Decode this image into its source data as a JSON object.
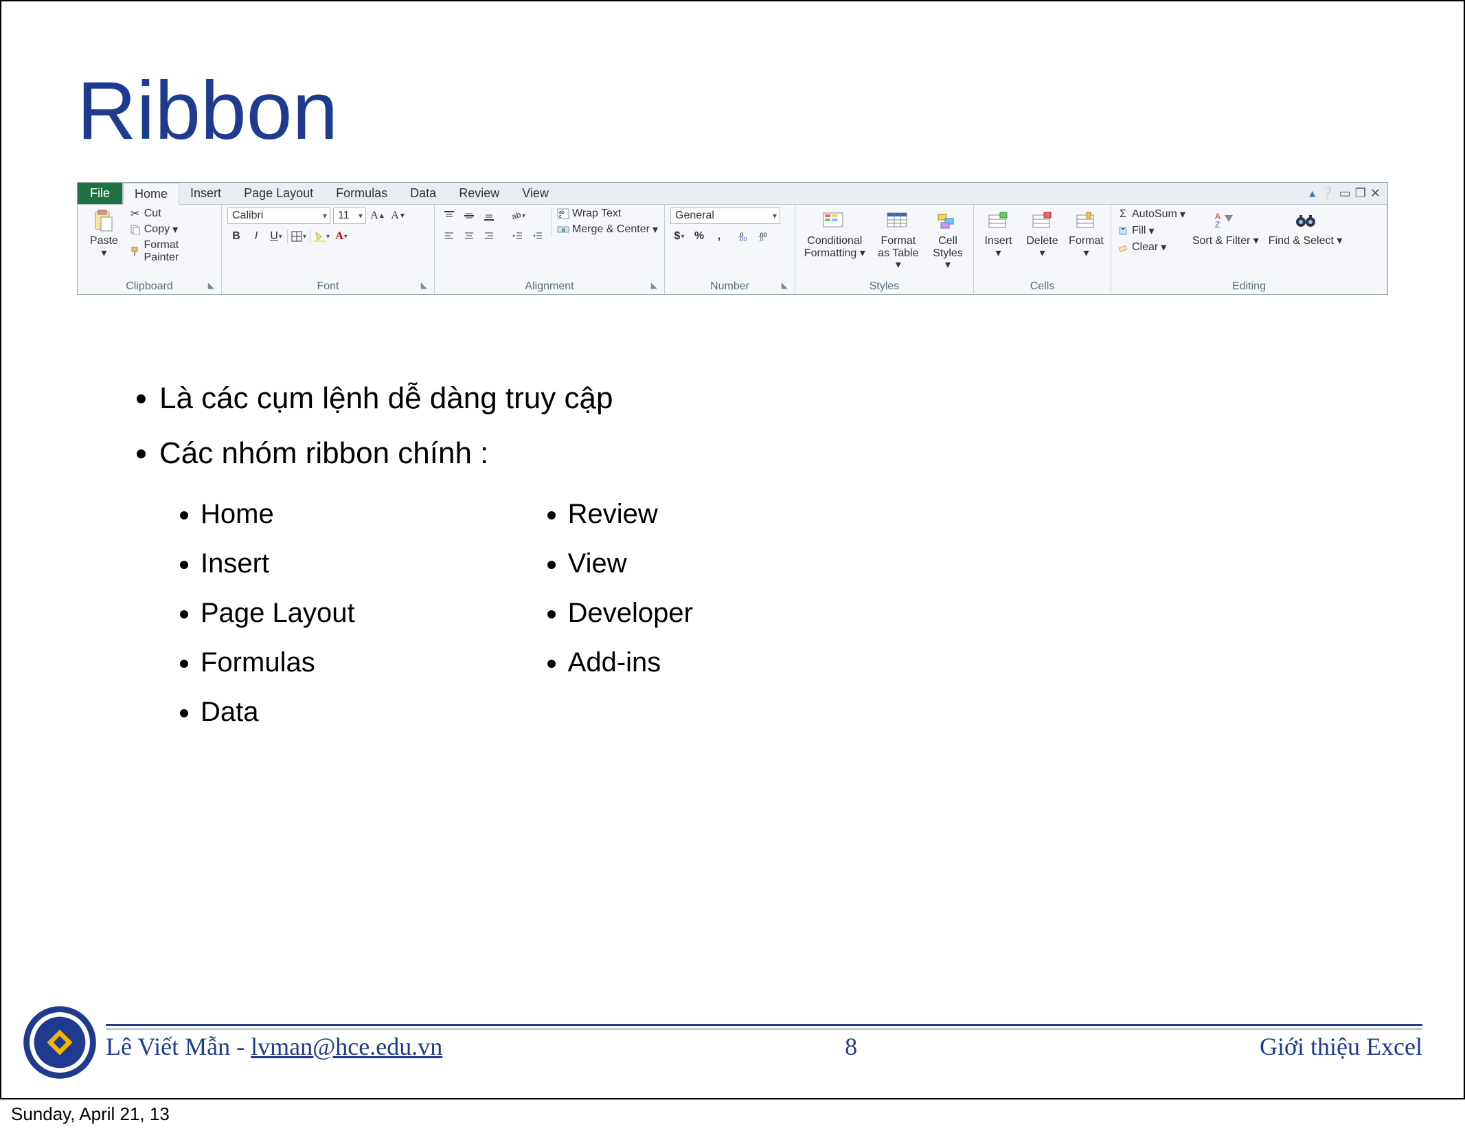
{
  "title": "Ribbon",
  "ribbon": {
    "tabs": {
      "file": "File",
      "home": "Home",
      "insert": "Insert",
      "pagelayout": "Page Layout",
      "formulas": "Formulas",
      "data": "Data",
      "review": "Review",
      "view": "View"
    },
    "clipboard": {
      "paste": "Paste",
      "cut": "Cut",
      "copy": "Copy",
      "format_painter": "Format Painter",
      "group": "Clipboard"
    },
    "font": {
      "name": "Calibri",
      "size": "11",
      "group": "Font"
    },
    "alignment": {
      "wrap": "Wrap Text",
      "merge": "Merge & Center",
      "group": "Alignment"
    },
    "number": {
      "format": "General",
      "group": "Number"
    },
    "styles": {
      "cf": "Conditional Formatting",
      "fat": "Format as Table",
      "cell": "Cell Styles",
      "group": "Styles"
    },
    "cells": {
      "insert": "Insert",
      "delete": "Delete",
      "format": "Format",
      "group": "Cells"
    },
    "editing": {
      "autosum": "AutoSum",
      "fill": "Fill",
      "clear": "Clear",
      "sort": "Sort & Filter",
      "find": "Find & Select",
      "group": "Editing"
    }
  },
  "bullets": {
    "b1": "Là các cụm lệnh dễ dàng truy cập",
    "b2": "Các nhóm ribbon chính :",
    "col1": {
      "i0": "Home",
      "i1": "Insert",
      "i2": "Page Layout",
      "i3": "Formulas",
      "i4": "Data"
    },
    "col2": {
      "i0": "Review",
      "i1": "View",
      "i2": "Developer",
      "i3": "Add-ins"
    }
  },
  "footer": {
    "author": "Lê Viết Mẫn - ",
    "email": "lvman@hce.edu.vn",
    "page": "8",
    "topic": "Giới thiệu Excel"
  },
  "datestamp": "Sunday, April 21, 13"
}
